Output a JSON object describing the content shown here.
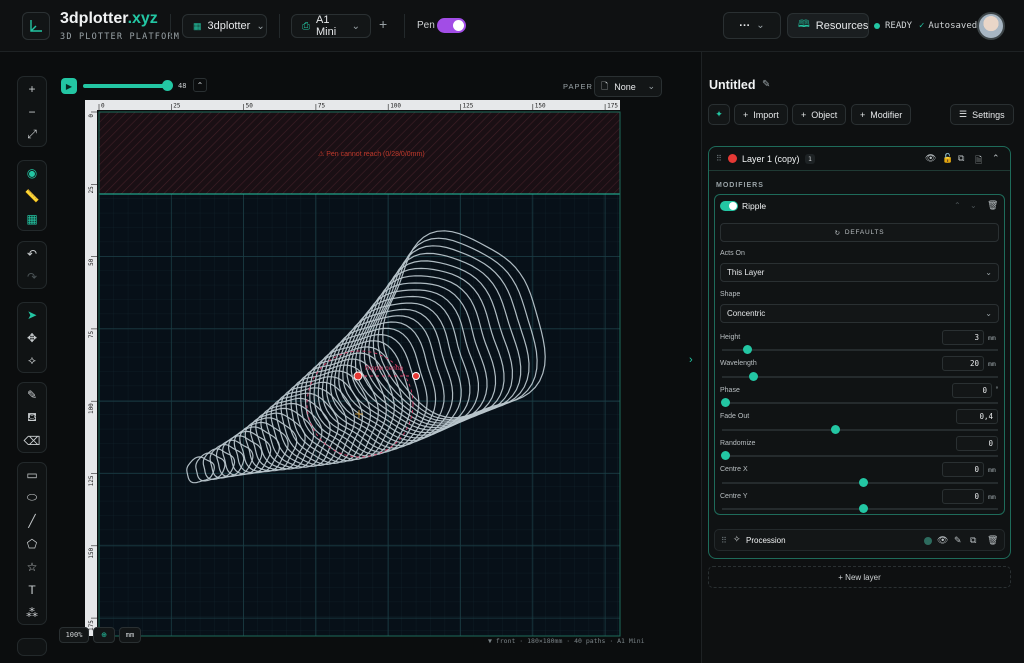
{
  "header": {
    "brand_name": "3dplotter",
    "brand_tld": ".xyz",
    "subtitle": "3D PLOTTER PLATFORM",
    "workspace": "3dplotter",
    "machine": "A1 Mini",
    "add": "+",
    "pen_label": "Pen",
    "pen_on": true,
    "more": "···",
    "resources": "Resources",
    "ready": "READY",
    "autosaved": "Autosaved"
  },
  "canvas": {
    "progress_value": "48",
    "progress_fraction": 0.95,
    "paper_label": "PAPER",
    "paper_value": "None",
    "warning": "⚠ Pen cannot reach (0/28/0/0mm)",
    "ripple_label": "Ripple centre",
    "x_ticks": [
      "0",
      "25",
      "50",
      "75",
      "100",
      "125",
      "150",
      "175"
    ],
    "y_ticks": [
      "0",
      "25",
      "50",
      "75",
      "100",
      "125",
      "150",
      "175"
    ],
    "zoom": "100%",
    "units": "mm",
    "status": "▼ front · 180×180mm · 40 paths · A1 Mini"
  },
  "sidebar": {
    "title": "Untitled",
    "import": "Import",
    "object": "Object",
    "modifier": "Modifier",
    "settings": "Settings",
    "layer": {
      "name": "Layer 1 (copy)",
      "count": "1",
      "color": "#e53935"
    },
    "modifiers_title": "MODIFIERS",
    "ripple": {
      "name": "Ripple",
      "defaults": "DEFAULTS",
      "acts_on_label": "Acts On",
      "acts_on_value": "This Layer",
      "shape_label": "Shape",
      "shape_value": "Concentric",
      "height": {
        "label": "Height",
        "value": "3",
        "unit": "mm",
        "fraction": 0.08
      },
      "wavelength": {
        "label": "Wavelength",
        "value": "20",
        "unit": "mm",
        "fraction": 0.1
      },
      "phase": {
        "label": "Phase",
        "value": "0",
        "unit": "°",
        "fraction": 0.0
      },
      "fade_out": {
        "label": "Fade Out",
        "value": "0,4",
        "fraction": 0.4
      },
      "randomize": {
        "label": "Randomize",
        "value": "0",
        "fraction": 0.0
      },
      "centre_x": {
        "label": "Centre X",
        "value": "0",
        "unit": "mm",
        "fraction": 0.5
      },
      "centre_y": {
        "label": "Centre Y",
        "value": "0",
        "unit": "mm",
        "fraction": 0.5
      }
    },
    "procession": "Procession",
    "new_layer": "+ New layer"
  }
}
